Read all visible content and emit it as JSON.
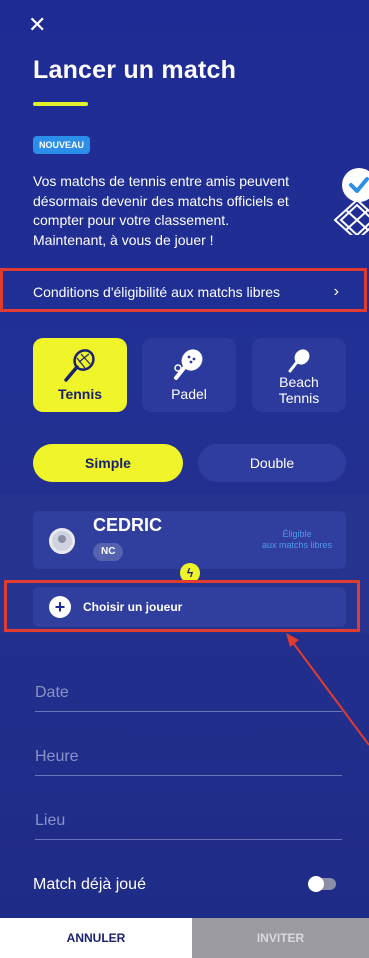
{
  "header": {
    "close_icon": "close-icon",
    "title": "Lancer un match"
  },
  "promo": {
    "badge": "NOUVEAU",
    "lines": [
      "Vos matchs de tennis entre amis peuvent",
      "désormais devenir des matchs officiels et",
      "compter pour votre classement.",
      "Maintenant, à vous de jouer !"
    ],
    "icon": "court-check-icon",
    "eligibility_link": "Conditions d'éligibilité aux matchs libres"
  },
  "sports": [
    {
      "label": "Tennis",
      "icon": "tennis-racket-icon",
      "selected": true
    },
    {
      "label": "Padel",
      "icon": "padel-racket-icon",
      "selected": false
    },
    {
      "label_line1": "Beach",
      "label_line2": "Tennis",
      "icon": "beach-tennis-racket-icon",
      "selected": false
    }
  ],
  "formats": [
    {
      "label": "Simple",
      "selected": true
    },
    {
      "label": "Double",
      "selected": false
    }
  ],
  "player": {
    "name": "CEDRIC",
    "rank": "NC",
    "eligible_line1": "Éligible",
    "eligible_line2": "aux matchs libres"
  },
  "choose_player": "Choisir un joueur",
  "fields": {
    "date_placeholder": "Date",
    "time_placeholder": "Heure",
    "place_placeholder": "Lieu"
  },
  "played": {
    "label": "Match déjà joué",
    "on": false
  },
  "footer": {
    "cancel": "ANNULER",
    "invite": "INVITER"
  },
  "colors": {
    "background": "#1e2b94",
    "accent_yellow": "#f0f52a",
    "highlight_red": "#e03c30",
    "eligible_blue": "#4f9af0"
  }
}
